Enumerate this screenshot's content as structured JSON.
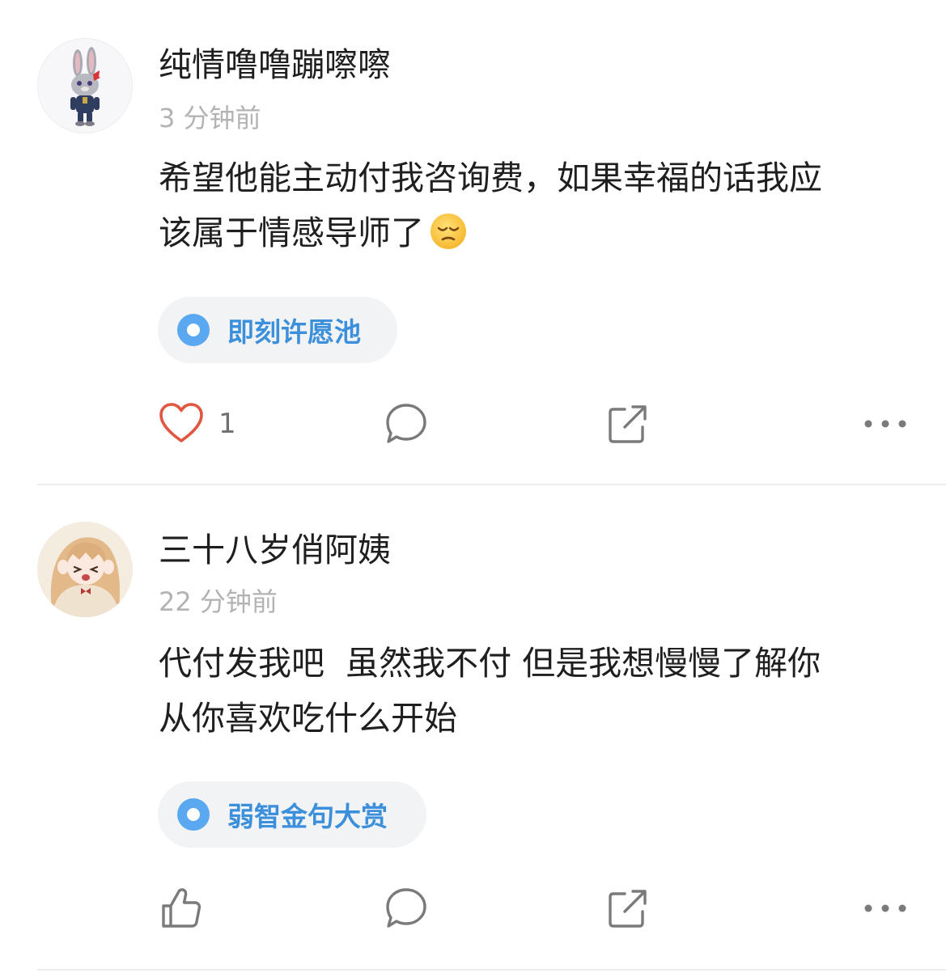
{
  "posts": [
    {
      "username": "纯情噜噜蹦嚓嚓",
      "time": "3 分钟前",
      "content_lines": [
        "希望他能主动付我咨询费，如果幸福的话我应",
        "该属于情感导师了"
      ],
      "emoji": "pensive-face",
      "topic": "即刻许愿池",
      "like_icon": "heart-icon",
      "like_count": "1"
    },
    {
      "username": "三十八岁俏阿姨",
      "time": "22 分钟前",
      "content_lines": [
        "代付发我吧  虽然我不付 但是我想慢慢了解你",
        "从你喜欢吃什么开始"
      ],
      "topic": "弱智金句大赏",
      "like_icon": "thumbs-up-icon"
    }
  ],
  "colors": {
    "accent": "#3c8fdb",
    "heart": "#e0563f",
    "icon": "#7a7a7a",
    "muted_text": "#b3b3b3",
    "tag_background": "#f2f3f5"
  }
}
